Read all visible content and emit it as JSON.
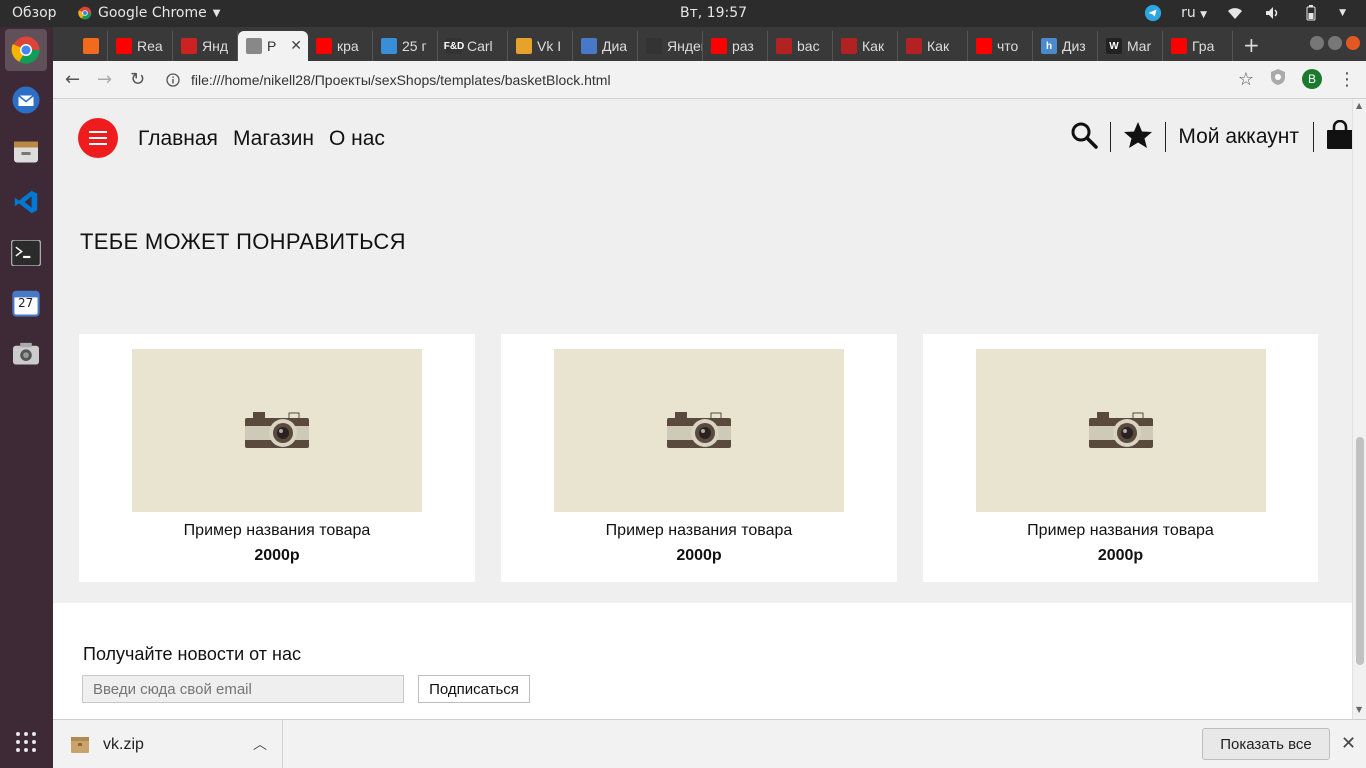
{
  "topbar": {
    "activities": "Обзор",
    "app_name": "Google Chrome",
    "clock": "Вт, 19:57",
    "lang": "ru"
  },
  "launcher": {
    "items": [
      "chrome-icon",
      "thunderbird-icon",
      "files-icon",
      "vscode-icon",
      "terminal-icon",
      "calendar-icon",
      "screenshot-icon",
      "apps-grid-icon"
    ],
    "calendar_day": "27"
  },
  "tabs": [
    {
      "label": "",
      "color": "#f26a1b"
    },
    {
      "label": "Rea",
      "color": "#ff0000"
    },
    {
      "label": "Янд",
      "color": "#cc2222"
    },
    {
      "label": "P",
      "color": "#888888",
      "active": true
    },
    {
      "label": "кра",
      "color": "#ff0000"
    },
    {
      "label": "25 г",
      "color": "#3a8ed8"
    },
    {
      "label": "Carl",
      "color": "#333333",
      "fav_text": "F&D"
    },
    {
      "label": "Vk I",
      "color": "#e6a22b"
    },
    {
      "label": "Диа",
      "color": "#4a78c8"
    },
    {
      "label": "Яндекс",
      "color": "#333333"
    },
    {
      "label": "раз",
      "color": "#ff0000"
    },
    {
      "label": "bac",
      "color": "#b22222"
    },
    {
      "label": "Как",
      "color": "#b22222"
    },
    {
      "label": "Как",
      "color": "#b22222"
    },
    {
      "label": "что",
      "color": "#ff0000"
    },
    {
      "label": "Диз",
      "color": "#4a8bd0",
      "fav_text": "h"
    },
    {
      "label": "Mar",
      "color": "#222222",
      "fav_text": "W"
    },
    {
      "label": "Гра",
      "color": "#ff0000"
    }
  ],
  "toolbar": {
    "url": "file:///home/nikell28/Проекты/sexShops/templates/basketBlock.html",
    "avatar_letter": "В"
  },
  "site": {
    "nav": [
      "Главная",
      "Магазин",
      "О нас"
    ],
    "account_label": "Мой аккаунт",
    "accent": "#ee1c1c",
    "rec_title": "ТЕБЕ МОЖЕТ ПОНРАВИТЬСЯ",
    "products": [
      {
        "name": "Пример названия товара",
        "price": "2000р"
      },
      {
        "name": "Пример названия товара",
        "price": "2000р"
      },
      {
        "name": "Пример названия товара",
        "price": "2000р"
      }
    ],
    "newsletter": {
      "title": "Получайте новости от нас",
      "email_placeholder": "Введи сюда свой email",
      "subscribe_label": "Подписаться"
    }
  },
  "downloads": {
    "file": "vk.zip",
    "show_all": "Показать все"
  }
}
